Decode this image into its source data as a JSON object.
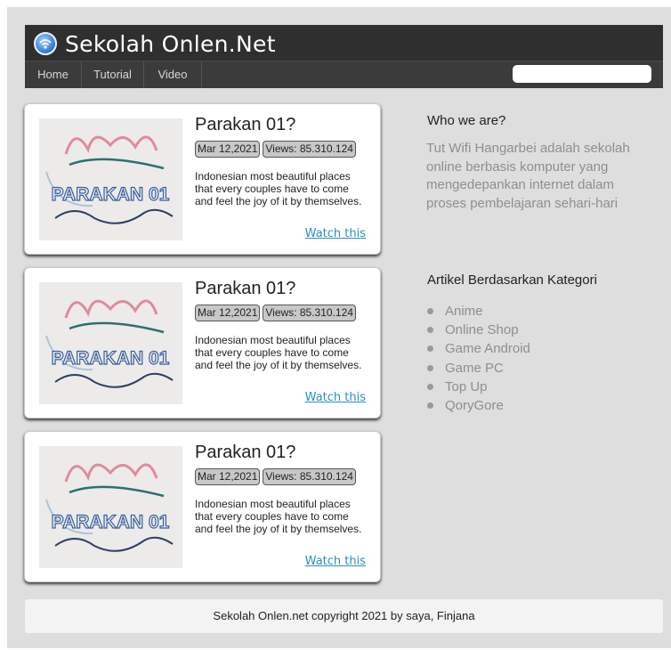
{
  "site": {
    "title": "Sekolah Onlen.Net"
  },
  "nav": {
    "items": [
      {
        "label": "Home"
      },
      {
        "label": "Tutorial"
      },
      {
        "label": "Video"
      }
    ]
  },
  "search": {
    "placeholder": ""
  },
  "cards": [
    {
      "title": "Parakan 01?",
      "date": "Mar 12,2021",
      "views": "Views: 85.310.124",
      "description": "Indonesian most beautiful places that every couples have to come and feel the joy of it by themselves.",
      "link": "Watch this",
      "thumb_text": "PARAKAN 01"
    },
    {
      "title": "Parakan 01?",
      "date": "Mar 12,2021",
      "views": "Views: 85.310.124",
      "description": "Indonesian most beautiful places that every couples have to come and feel the joy of it by themselves.",
      "link": "Watch this",
      "thumb_text": "PARAKAN 01"
    },
    {
      "title": "Parakan 01?",
      "date": "Mar 12,2021",
      "views": "Views: 85.310.124",
      "description": "Indonesian most beautiful places that every couples have to come and feel the joy of it by themselves.",
      "link": "Watch this",
      "thumb_text": "PARAKAN 01"
    }
  ],
  "sidebar": {
    "about_title": "Who we are?",
    "about_text": "Tut Wifi Hangarbei adalah sekolah online berbasis komputer yang mengedepankan internet dalam proses pembelajaran sehari-hari",
    "category_title": "Artikel Berdasarkan Kategori",
    "categories": [
      "Anime",
      "Online Shop",
      "Game Android",
      "Game PC",
      "Top Up",
      "QoryGore"
    ]
  },
  "footer": {
    "text": "Sekolah Onlen.net copyright 2021 by saya, Finjana"
  },
  "colors": {
    "header": "#2f2f2f",
    "link": "#2a8fbf",
    "muted_text": "#8e8e8e",
    "page_bg": "#dedede"
  },
  "icons": {
    "logo": "wifi-globe-icon",
    "bullet": "bullet-icon"
  }
}
